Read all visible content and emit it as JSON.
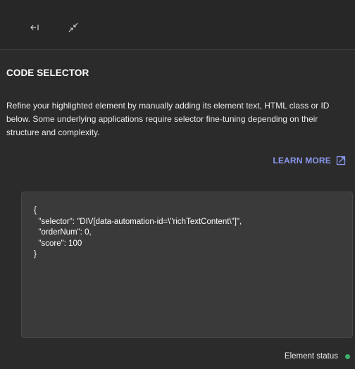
{
  "toolbar": {
    "collapse_icon": "arrow-left-to-bar-icon",
    "minimize_icon": "arrows-collapse-icon"
  },
  "section": {
    "title": "CODE SELECTOR",
    "description": "Refine your highlighted element by manually adding its element text, HTML class or ID below. Some underlying applications require selector fine-tuning depending on their structure and complexity.",
    "learn_more_label": "LEARN MORE",
    "learn_more_icon": "external-link-icon"
  },
  "code": {
    "value": "{\n  \"selector\": \"DIV[data-automation-id=\\\"richTextContent\\\"]\",\n  \"orderNum\": 0,\n  \"score\": 100\n}"
  },
  "status": {
    "label": "Element status",
    "indicator_color": "#38b26a"
  },
  "colors": {
    "background": "#2b2b2b",
    "accent_link": "#8b97ee",
    "code_background": "#3a3a3a"
  }
}
